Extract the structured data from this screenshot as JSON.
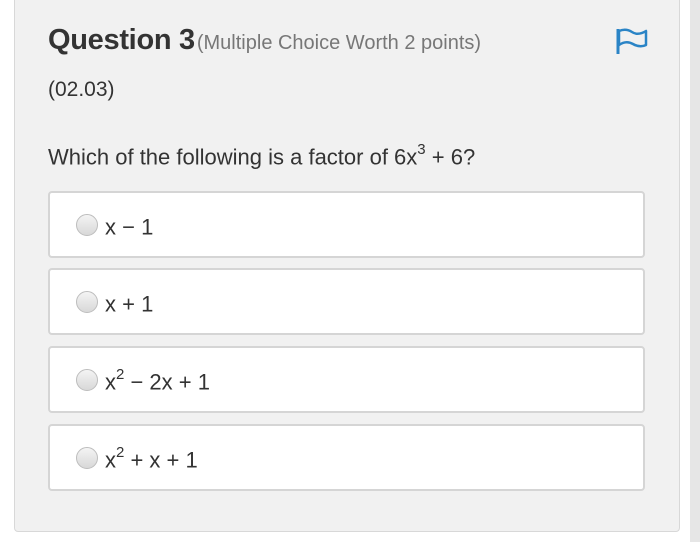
{
  "question": {
    "title": "Question 3",
    "meta": "(Multiple Choice Worth 2 points)",
    "code": "(02.03)",
    "prompt_text": "Which of the following is a factor of 6x",
    "prompt_sup": "3",
    "prompt_tail": " + 6?"
  },
  "flag_icon": "flag-icon",
  "options": [
    {
      "base": "x − 1",
      "sup": "",
      "tail": ""
    },
    {
      "base": "x + 1",
      "sup": "",
      "tail": ""
    },
    {
      "base": "x",
      "sup": "2",
      "tail": " − 2x + 1"
    },
    {
      "base": "x",
      "sup": "2",
      "tail": " + x + 1"
    }
  ],
  "colors": {
    "flag": "#2a84c6",
    "panel": "#f1f1f1",
    "option_border": "#d5d5d5"
  }
}
